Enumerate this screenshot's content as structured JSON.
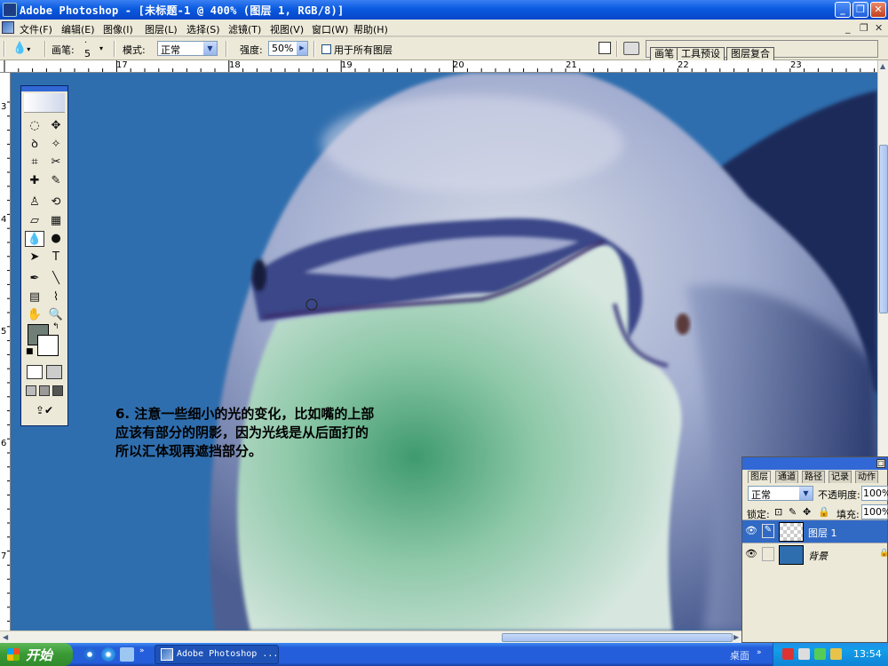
{
  "window": {
    "title": "Adobe Photoshop - [未标题-1 @ 400% (图层 1, RGB/8)]",
    "min_glyph": "_",
    "max_glyph": "❐",
    "close_glyph": "✕"
  },
  "menu": {
    "items": [
      "文件(F)",
      "编辑(E)",
      "图像(I)",
      "图层(L)",
      "选择(S)",
      "滤镜(T)",
      "视图(V)",
      "窗口(W)",
      "帮助(H)"
    ],
    "doc_controls": [
      "_",
      "❐",
      "✕"
    ]
  },
  "options": {
    "brush_label": "画笔:",
    "brush_size": "5",
    "mode_label": "模式:",
    "mode_value": "正常",
    "strength_label": "强度:",
    "strength_value": "50%",
    "all_layers_label": "用于所有图层",
    "palette_tabs": [
      "画笔",
      "工具预设",
      "图层复合"
    ]
  },
  "rulers": {
    "h_labels": [
      "17",
      "18",
      "19",
      "20",
      "21",
      "22",
      "23"
    ],
    "v_labels": [
      "3",
      "4",
      "5",
      "6",
      "7"
    ]
  },
  "note": {
    "lines": [
      "6. 注意一些细小的光的变化，比如嘴的上部",
      "应该有部分的阴影，因为光线是从后面打的",
      "所以汇体现再遮挡部分。"
    ]
  },
  "tools": [
    "marquee-icon",
    "move-icon",
    "lasso-icon",
    "magic-wand-icon",
    "crop-icon",
    "slice-icon",
    "healing-icon",
    "brush-icon",
    "stamp-icon",
    "history-brush-icon",
    "eraser-icon",
    "gradient-icon",
    "blur-icon",
    "dodge-icon",
    "path-select-icon",
    "type-icon",
    "pen-icon",
    "line-icon",
    "notes-icon",
    "eyedropper-icon",
    "hand-icon",
    "zoom-icon"
  ],
  "layers_panel": {
    "tabs": [
      "图层",
      "通道",
      "路径",
      "记录",
      "动作"
    ],
    "blend_mode": "正常",
    "opacity_label": "不透明度:",
    "opacity_value": "100%",
    "lock_label": "锁定:",
    "fill_label": "填充:",
    "fill_value": "100%",
    "layers": [
      {
        "name": "图层 1",
        "selected": true
      },
      {
        "name": "背景",
        "selected": false
      }
    ]
  },
  "taskbar": {
    "start_label": "开始",
    "task_label": "Adobe Photoshop ...",
    "desktop_label": "桌面",
    "clock": "13:54"
  },
  "colors": {
    "canvas_bg": "#2f6eae",
    "foreground_swatch": "#6f7f77",
    "background_swatch": "#ffffff"
  }
}
